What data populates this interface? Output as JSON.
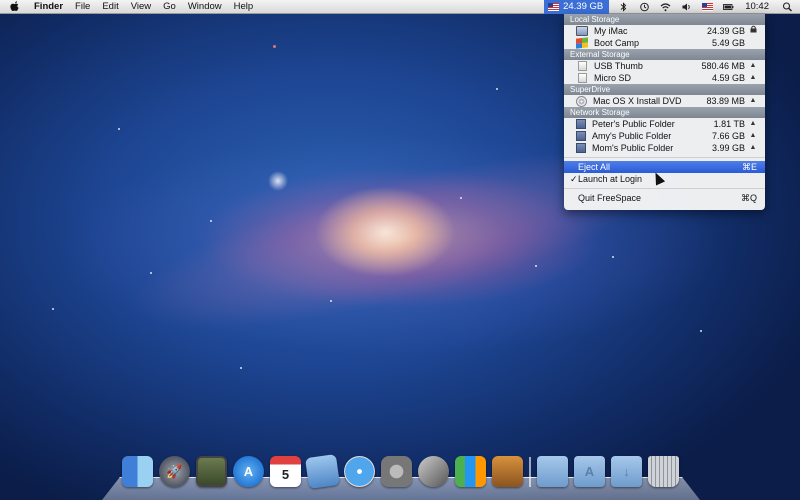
{
  "menubar": {
    "app_name": "Finder",
    "menus": [
      "File",
      "Edit",
      "View",
      "Go",
      "Window",
      "Help"
    ],
    "freespace_value": "24.39 GB",
    "clock": "10:42"
  },
  "dropdown": {
    "sections": [
      {
        "title": "Local Storage",
        "items": [
          {
            "name": "My iMac",
            "size": "24.39 GB",
            "icon": "imac-icon",
            "action": "lock-icon"
          },
          {
            "name": "Boot Camp",
            "size": "5.49 GB",
            "icon": "windows-icon",
            "action": ""
          }
        ]
      },
      {
        "title": "External Storage",
        "items": [
          {
            "name": "USB Thumb",
            "size": "580.46 MB",
            "icon": "drive-icon",
            "action": "eject-icon"
          },
          {
            "name": "Micro SD",
            "size": "4.59 GB",
            "icon": "drive-icon",
            "action": "eject-icon"
          }
        ]
      },
      {
        "title": "SuperDrive",
        "items": [
          {
            "name": "Mac OS X Install DVD",
            "size": "83.89 MB",
            "icon": "dvd-icon",
            "action": "eject-icon"
          }
        ]
      },
      {
        "title": "Network Storage",
        "items": [
          {
            "name": "Peter's Public Folder",
            "size": "1.81 TB",
            "icon": "network-drive-icon",
            "action": "eject-icon"
          },
          {
            "name": "Amy's Public Folder",
            "size": "7.66 GB",
            "icon": "network-drive-icon",
            "action": "eject-icon"
          },
          {
            "name": "Mom's Public Folder",
            "size": "3.99 GB",
            "icon": "network-drive-icon",
            "action": "eject-icon"
          }
        ]
      }
    ],
    "commands": {
      "eject_all": "Eject All",
      "eject_all_shortcut": "⌘E",
      "launch_at_login": "Launch at Login",
      "launch_checkmark": "✓",
      "quit": "Quit FreeSpace",
      "quit_shortcut": "⌘Q"
    }
  },
  "dock": {
    "calendar_day": "5",
    "icons": [
      "finder-icon",
      "launchpad-icon",
      "photo-booth-icon",
      "app-store-icon",
      "calendar-icon",
      "mail-icon",
      "safari-icon",
      "system-preferences-icon",
      "quill-icon",
      "numbers-icon",
      "keynote-icon",
      "documents-folder-icon",
      "applications-folder-icon",
      "downloads-folder-icon",
      "trash-icon"
    ]
  }
}
